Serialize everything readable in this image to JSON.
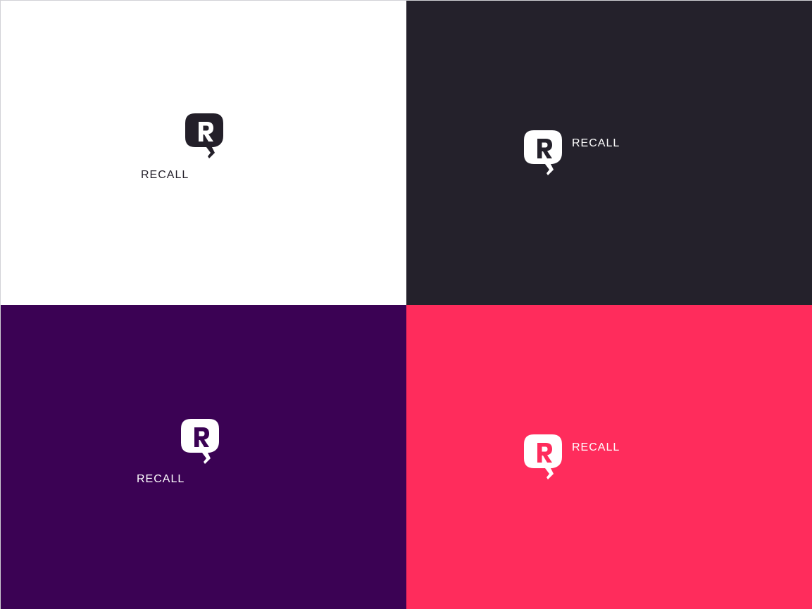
{
  "brand": {
    "name": "RECALL"
  },
  "variants": [
    {
      "id": "light",
      "background": "#ffffff",
      "foreground": "#231f29",
      "knockout": "#ffffff",
      "layout": "stacked"
    },
    {
      "id": "dark",
      "background": "#24212b",
      "foreground": "#ffffff",
      "knockout": "#24212b",
      "layout": "horizontal"
    },
    {
      "id": "purple",
      "background": "#3b0254",
      "foreground": "#ffffff",
      "knockout": "#3b0254",
      "layout": "stacked"
    },
    {
      "id": "pink",
      "background": "#ff2c5c",
      "foreground": "#ffffff",
      "knockout": "#ff2c5c",
      "layout": "horizontal"
    }
  ],
  "icon": "speech-bubble-r-icon"
}
